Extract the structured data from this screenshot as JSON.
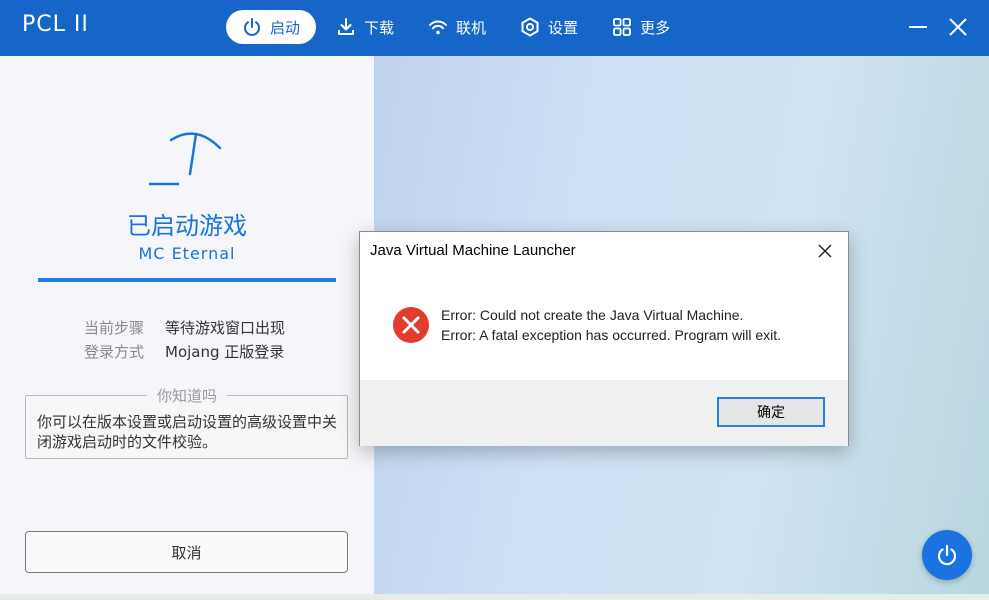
{
  "app": {
    "brand": "PCL II"
  },
  "nav": {
    "items": [
      {
        "label": "启动",
        "icon": "power-icon",
        "active": true
      },
      {
        "label": "下载",
        "icon": "download-icon",
        "active": false
      },
      {
        "label": "联机",
        "icon": "wifi-icon",
        "active": false
      },
      {
        "label": "设置",
        "icon": "gear-icon",
        "active": false
      },
      {
        "label": "更多",
        "icon": "grid-icon",
        "active": false
      }
    ]
  },
  "launch": {
    "status": "已启动游戏",
    "version": "MC  Eternal",
    "progress": 1.0,
    "step_label": "当前步骤",
    "step_value": "等待游戏窗口出现",
    "login_label": "登录方式",
    "login_value": "Mojang 正版登录",
    "tip_title": "你知道吗",
    "tip_text": "你可以在版本设置或启动设置的高级设置中关闭游戏启动时的文件校验。",
    "cancel_label": "取消"
  },
  "dialog": {
    "title": "Java Virtual Machine Launcher",
    "line1": "Error: Could not create the Java Virtual Machine.",
    "line2": "Error: A fatal exception has occurred. Program will exit.",
    "ok_label": "确定"
  },
  "colors": {
    "accent": "#1665c8",
    "error": "#e33b2e"
  }
}
